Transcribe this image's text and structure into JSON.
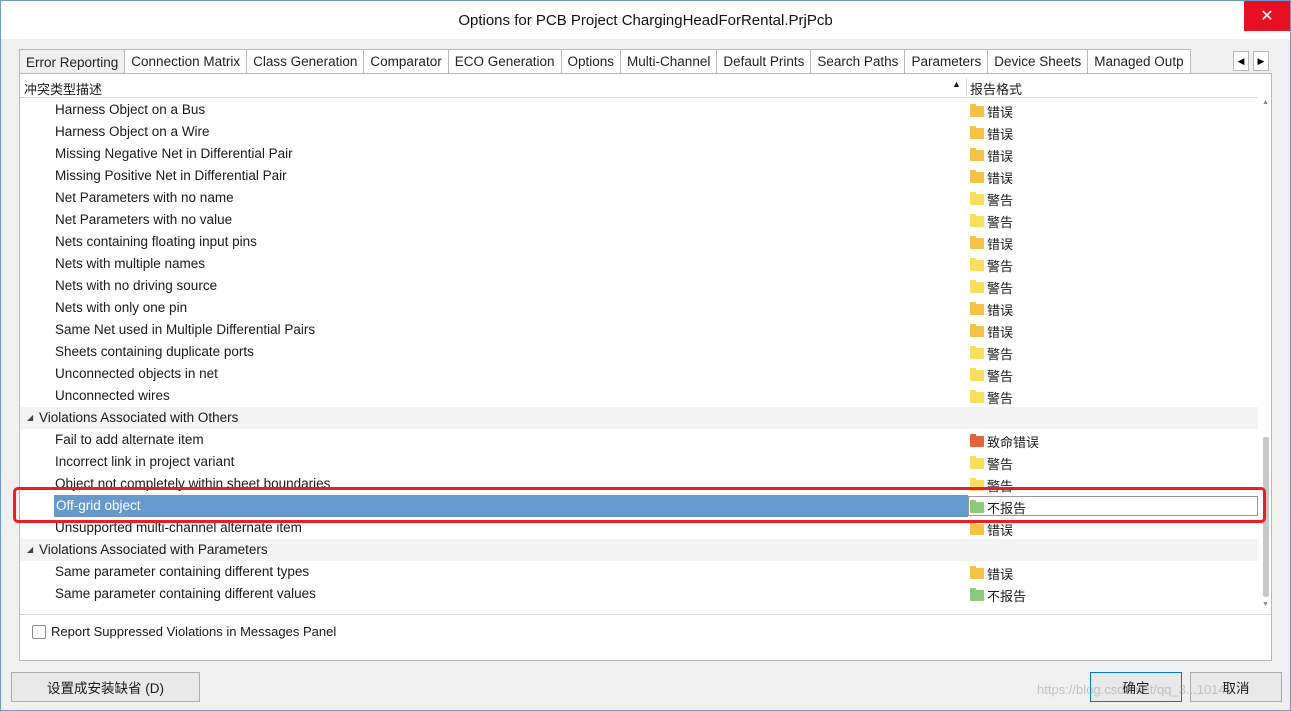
{
  "window": {
    "title": "Options for PCB Project ChargingHeadForRental.PrjPcb",
    "close_glyph": "✕"
  },
  "tabs": [
    {
      "label": "Error Reporting",
      "active": true
    },
    {
      "label": "Connection Matrix"
    },
    {
      "label": "Class Generation"
    },
    {
      "label": "Comparator"
    },
    {
      "label": "ECO Generation"
    },
    {
      "label": "Options"
    },
    {
      "label": "Multi-Channel"
    },
    {
      "label": "Default Prints"
    },
    {
      "label": "Search Paths"
    },
    {
      "label": "Parameters"
    },
    {
      "label": "Device Sheets"
    },
    {
      "label": "Managed Outp"
    }
  ],
  "tab_scroll": {
    "left": "◀",
    "right": "▶"
  },
  "list": {
    "col1_header": "冲突类型描述",
    "col2_header": "报告格式",
    "sort_glyph": "▲",
    "rows": [
      {
        "type": "item",
        "label": "Harness Object on a Bus",
        "severity": "错误",
        "color": "#f4c247"
      },
      {
        "type": "item",
        "label": "Harness Object on a Wire",
        "severity": "错误",
        "color": "#f4c247"
      },
      {
        "type": "item",
        "label": "Missing Negative Net in Differential Pair",
        "severity": "错误",
        "color": "#f4c247"
      },
      {
        "type": "item",
        "label": "Missing Positive Net in Differential Pair",
        "severity": "错误",
        "color": "#f4c247"
      },
      {
        "type": "item",
        "label": "Net Parameters with no name",
        "severity": "警告",
        "color": "#f8e05e"
      },
      {
        "type": "item",
        "label": "Net Parameters with no value",
        "severity": "警告",
        "color": "#f8e05e"
      },
      {
        "type": "item",
        "label": "Nets containing floating input pins",
        "severity": "错误",
        "color": "#f4c247"
      },
      {
        "type": "item",
        "label": "Nets with multiple names",
        "severity": "警告",
        "color": "#f8e05e"
      },
      {
        "type": "item",
        "label": "Nets with no driving source",
        "severity": "警告",
        "color": "#f8e05e"
      },
      {
        "type": "item",
        "label": "Nets with only one pin",
        "severity": "错误",
        "color": "#f4c247"
      },
      {
        "type": "item",
        "label": "Same Net used in Multiple Differential Pairs",
        "severity": "错误",
        "color": "#f4c247"
      },
      {
        "type": "item",
        "label": "Sheets containing duplicate ports",
        "severity": "警告",
        "color": "#f8e05e"
      },
      {
        "type": "item",
        "label": "Unconnected objects in net",
        "severity": "警告",
        "color": "#f8e05e"
      },
      {
        "type": "item",
        "label": "Unconnected wires",
        "severity": "警告",
        "color": "#f8e05e"
      },
      {
        "type": "group",
        "label": "Violations Associated with Others"
      },
      {
        "type": "item",
        "label": "Fail to add alternate item",
        "severity": "致命错误",
        "color": "#e2643c"
      },
      {
        "type": "item",
        "label": "Incorrect link in project variant",
        "severity": "警告",
        "color": "#f8e05e"
      },
      {
        "type": "item",
        "label": "Object not completely within sheet boundaries",
        "severity": "警告",
        "color": "#f8e05e"
      },
      {
        "type": "item",
        "label": "Off-grid object",
        "severity": "不报告",
        "color": "#8cc97e",
        "selected": true
      },
      {
        "type": "item",
        "label": "Unsupported multi-channel alternate item",
        "severity": "错误",
        "color": "#f4c247"
      },
      {
        "type": "group",
        "label": "Violations Associated with Parameters"
      },
      {
        "type": "item",
        "label": "Same parameter containing different types",
        "severity": "错误",
        "color": "#f4c247"
      },
      {
        "type": "item",
        "label": "Same parameter containing different values",
        "severity": "不报告",
        "color": "#8cc97e"
      }
    ]
  },
  "suppress_label": "Report Suppressed Violations in Messages Panel",
  "buttons": {
    "defaults": "设置成安装缺省 (D)",
    "ok": "确定",
    "cancel": "取消"
  },
  "watermark": "https://blog.csdn.net/qq_3...1014"
}
